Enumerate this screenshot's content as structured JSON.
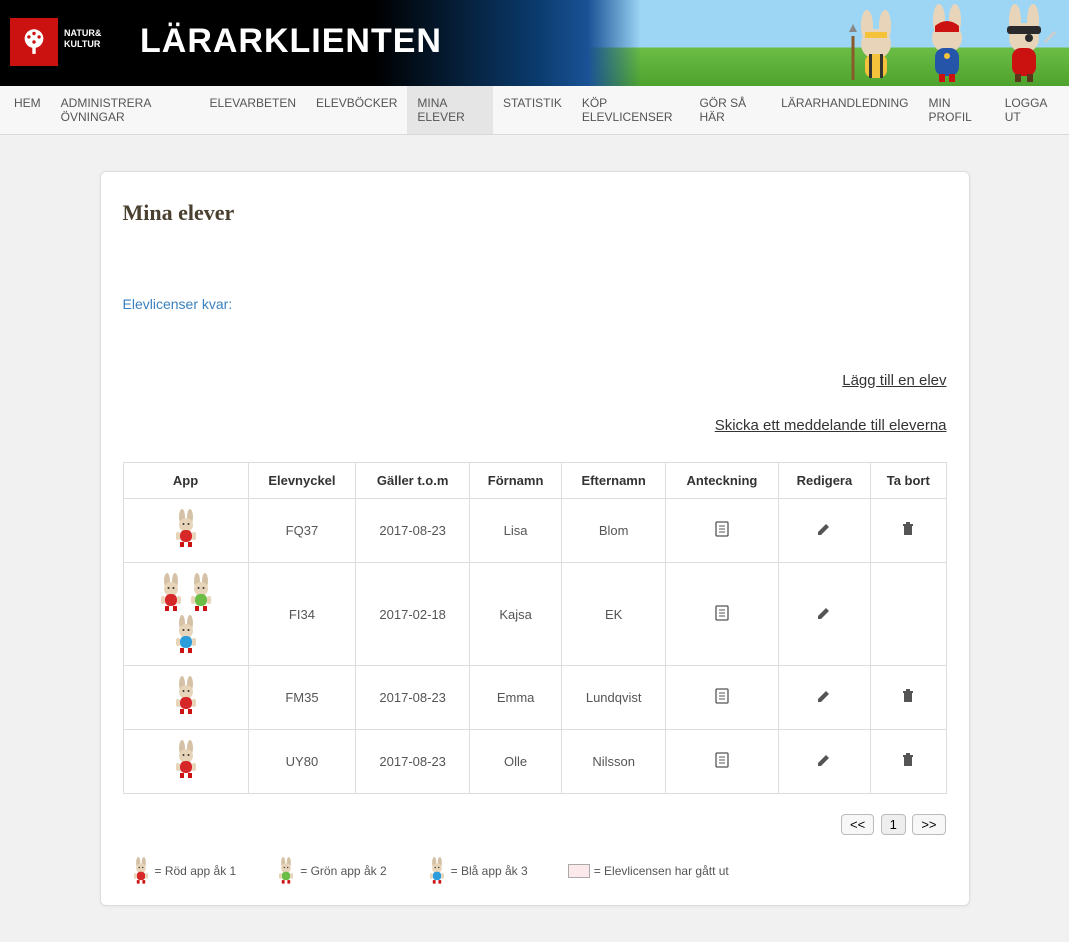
{
  "header": {
    "brand_line1": "NATUR&",
    "brand_line2": "KULTUR",
    "title": "LÄRARKLIENTEN"
  },
  "nav": {
    "items": [
      {
        "label": "HEM",
        "active": false
      },
      {
        "label": "ADMINISTRERA ÖVNINGAR",
        "active": false
      },
      {
        "label": "ELEVARBETEN",
        "active": false
      },
      {
        "label": "ELEVBÖCKER",
        "active": false
      },
      {
        "label": "MINA ELEVER",
        "active": true
      },
      {
        "label": "STATISTIK",
        "active": false
      },
      {
        "label": "KÖP ELEVLICENSER",
        "active": false
      },
      {
        "label": "GÖR SÅ HÄR",
        "active": false
      },
      {
        "label": "LÄRARHANDLEDNING",
        "active": false
      },
      {
        "label": "MIN PROFIL",
        "active": false
      },
      {
        "label": "LOGGA UT",
        "active": false
      }
    ]
  },
  "page": {
    "title": "Mina elever",
    "licenses_label": "Elevlicenser kvar:",
    "add_student_link": "Lägg till en elev",
    "send_message_link": "Skicka ett meddelande till eleverna"
  },
  "table": {
    "headers": {
      "app": "App",
      "key": "Elevnyckel",
      "valid": "Gäller t.o.m",
      "fname": "Förnamn",
      "lname": "Efternamn",
      "note": "Anteckning",
      "edit": "Redigera",
      "del": "Ta bort"
    },
    "rows": [
      {
        "apps": [
          "red"
        ],
        "key": "FQ37",
        "valid": "2017-08-23",
        "fname": "Lisa",
        "lname": "Blom",
        "deletable": true
      },
      {
        "apps": [
          "red",
          "green",
          "blue"
        ],
        "key": "FI34",
        "valid": "2017-02-18",
        "fname": "Kajsa",
        "lname": "EK",
        "deletable": false
      },
      {
        "apps": [
          "red"
        ],
        "key": "FM35",
        "valid": "2017-08-23",
        "fname": "Emma",
        "lname": "Lundqvist",
        "deletable": true
      },
      {
        "apps": [
          "red"
        ],
        "key": "UY80",
        "valid": "2017-08-23",
        "fname": "Olle",
        "lname": "Nilsson",
        "deletable": true
      }
    ]
  },
  "pagination": {
    "first": "<<",
    "page": "1",
    "last": ">>"
  },
  "legend": {
    "red": "= Röd app åk 1",
    "green": "= Grön app åk 2",
    "blue": "= Blå app åk 3",
    "expired": "= Elevlicensen har gått ut"
  },
  "colors": {
    "red": "#d62828",
    "green": "#6bbd45",
    "blue": "#2d9cdb",
    "skin": "#e8d5b9",
    "ear": "#d5c2a6"
  }
}
